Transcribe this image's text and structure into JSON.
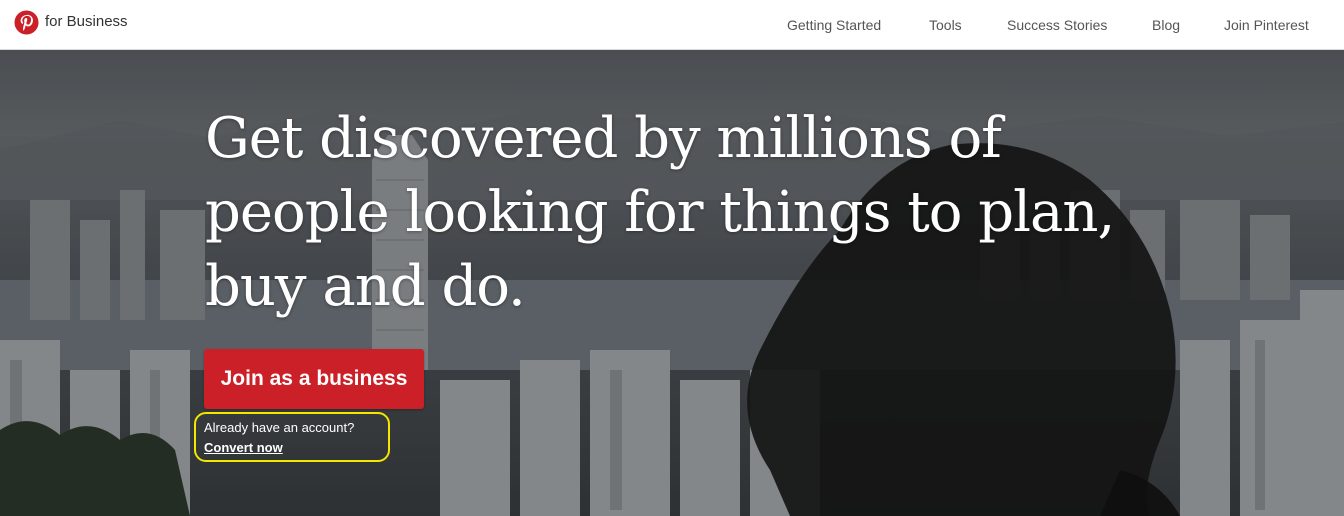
{
  "header": {
    "brand_text": "for Business",
    "logo_icon": "pinterest-logo-icon",
    "nav_items": [
      {
        "label": "Getting Started"
      },
      {
        "label": "Tools"
      },
      {
        "label": "Success Stories"
      },
      {
        "label": "Blog"
      },
      {
        "label": "Join Pinterest"
      }
    ]
  },
  "hero": {
    "headline": "Get discovered by millions of people looking for things to plan, buy and do.",
    "cta_label": "Join as a business",
    "account_prompt": "Already have an account?",
    "convert_link": "Convert now"
  },
  "colors": {
    "brand_red": "#cb2027",
    "highlight_outline": "#f3e600",
    "nav_text": "#555555"
  }
}
